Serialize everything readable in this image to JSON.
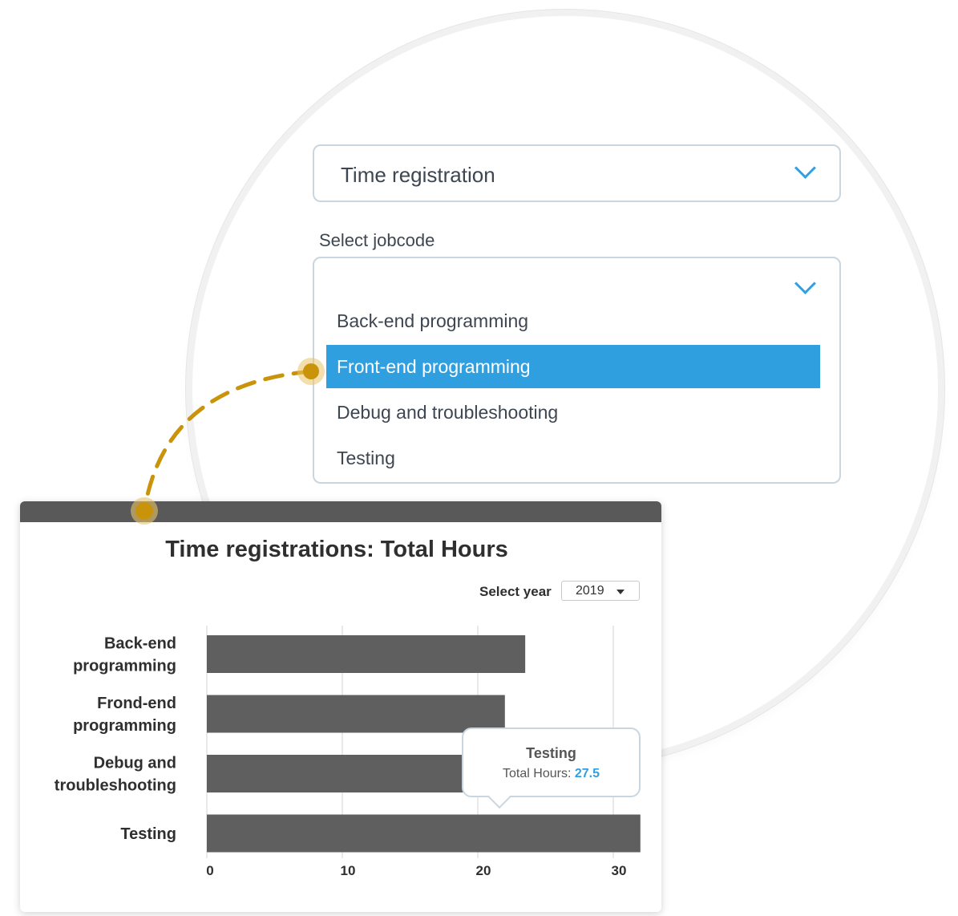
{
  "zoom": {
    "main_select": {
      "value": "Time registration"
    },
    "jobcode": {
      "label": "Select jobcode",
      "options": [
        "Back-end programming",
        "Front-end programming",
        "Debug and troubleshooting",
        "Testing"
      ],
      "selected_index": 1
    }
  },
  "panel": {
    "year_label": "Select year",
    "year_value": "2019"
  },
  "chart_data": {
    "type": "bar",
    "orientation": "horizontal",
    "title": "Time registrations: Total Hours",
    "categories": [
      [
        "Back-end",
        "programming"
      ],
      [
        "Frond-end",
        "programming"
      ],
      [
        "Debug and",
        "troubleshooting"
      ],
      [
        "Testing"
      ]
    ],
    "values": [
      23.5,
      22,
      19,
      32
    ],
    "xticks": [
      "0",
      "10",
      "20",
      "30"
    ],
    "xlim": [
      0,
      35
    ],
    "grid": true,
    "tooltip": {
      "category": "Testing",
      "label": "Total Hours:",
      "value": "27.5"
    }
  },
  "colors": {
    "accent": "#2f9fe0",
    "bar": "#5f5f5f",
    "connector": "#c9940a"
  }
}
